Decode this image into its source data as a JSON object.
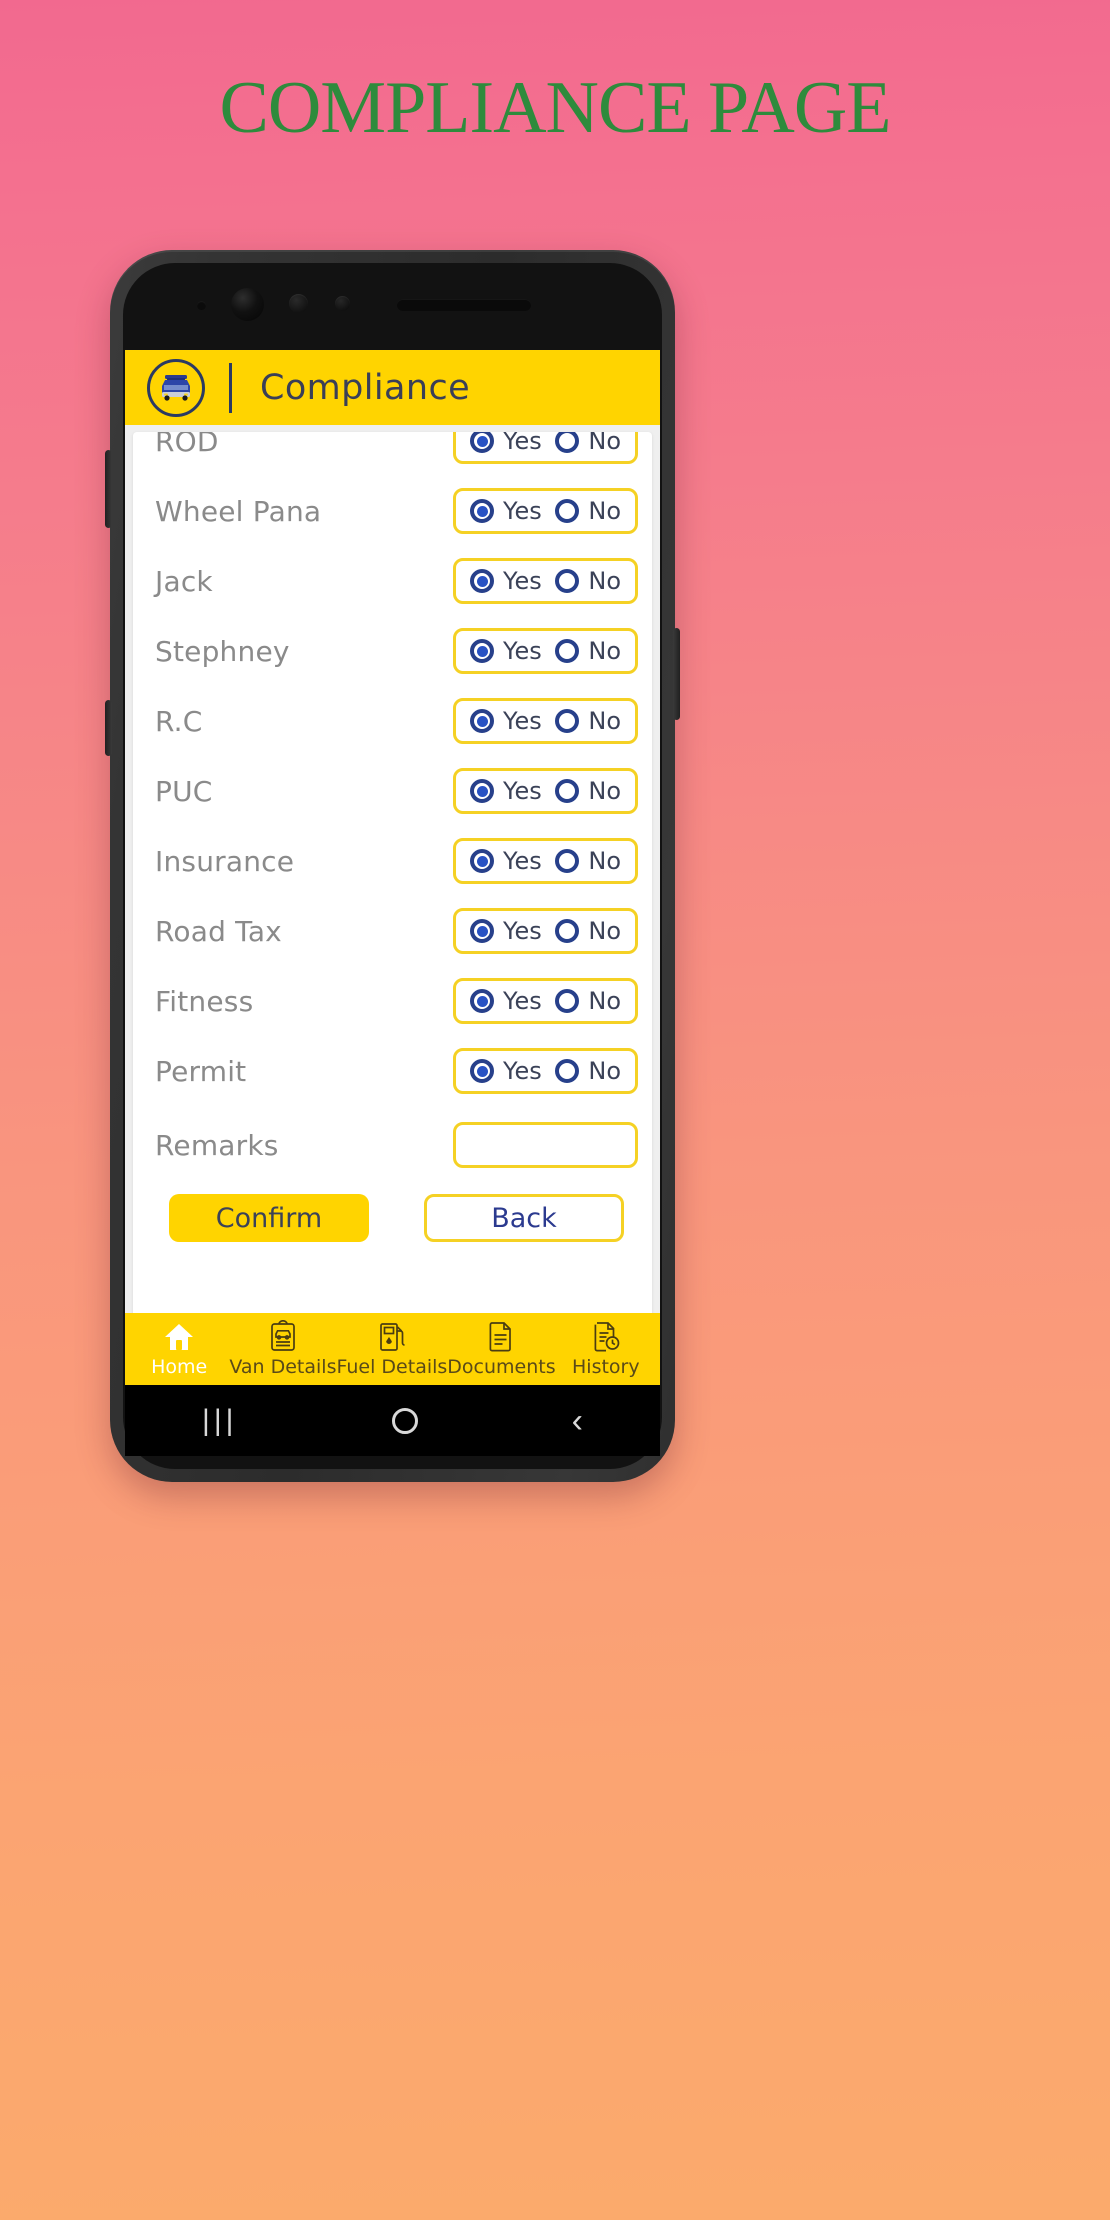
{
  "page": {
    "title": "COMPLIANCE PAGE",
    "title_color": "#2e8b3c",
    "background_gradient_from": "#f2698f",
    "background_gradient_to": "#fbaa6c"
  },
  "theme": {
    "accent_yellow": "#ffd400",
    "border_yellow": "#f5d124",
    "navy": "#27408b",
    "label_gray": "#8a8a8a"
  },
  "app_bar": {
    "title": "Compliance",
    "logo_icon": "van-logo-icon"
  },
  "form": {
    "rows": [
      {
        "label": "ROD",
        "yes": "Yes",
        "no": "No",
        "selected": "yes"
      },
      {
        "label": "Wheel Pana",
        "yes": "Yes",
        "no": "No",
        "selected": "yes"
      },
      {
        "label": "Jack",
        "yes": "Yes",
        "no": "No",
        "selected": "yes"
      },
      {
        "label": "Stephney",
        "yes": "Yes",
        "no": "No",
        "selected": "yes"
      },
      {
        "label": "R.C",
        "yes": "Yes",
        "no": "No",
        "selected": "yes"
      },
      {
        "label": "PUC",
        "yes": "Yes",
        "no": "No",
        "selected": "yes"
      },
      {
        "label": "Insurance",
        "yes": "Yes",
        "no": "No",
        "selected": "yes"
      },
      {
        "label": "Road Tax",
        "yes": "Yes",
        "no": "No",
        "selected": "yes"
      },
      {
        "label": "Fitness",
        "yes": "Yes",
        "no": "No",
        "selected": "yes"
      },
      {
        "label": "Permit",
        "yes": "Yes",
        "no": "No",
        "selected": "yes"
      }
    ],
    "remarks": {
      "label": "Remarks",
      "value": "",
      "placeholder": ""
    },
    "confirm_label": "Confirm",
    "back_label": "Back"
  },
  "bottom_nav": {
    "items": [
      {
        "label": "Home",
        "icon": "home-icon",
        "active": true
      },
      {
        "label": "Van Details",
        "icon": "clipboard-van-icon",
        "active": false
      },
      {
        "label": "Fuel Details",
        "icon": "fuel-pump-icon",
        "active": false
      },
      {
        "label": "Documents",
        "icon": "document-icon",
        "active": false
      },
      {
        "label": "History",
        "icon": "history-doc-icon",
        "active": false
      }
    ]
  },
  "system_bar": {
    "recents": "|||",
    "home": "",
    "back": "‹"
  }
}
